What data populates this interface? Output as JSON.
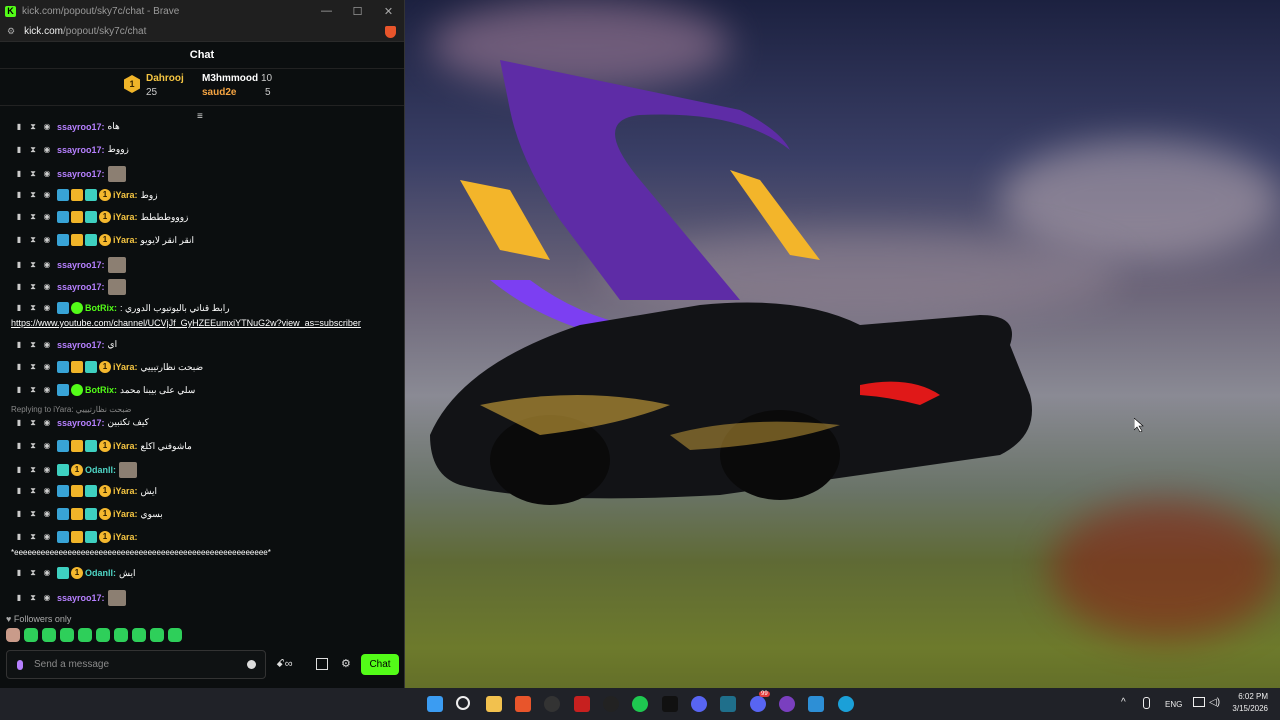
{
  "browser": {
    "title": "kick.com/popout/sky7c/chat - Brave",
    "url_host": "kick.com",
    "url_path": "/popout/sky7c/chat",
    "controls": {
      "minimize": "—",
      "maximize": "☐",
      "close": "✕"
    }
  },
  "chat": {
    "header": "Chat",
    "leaderboard": [
      {
        "name": "Dahrooj",
        "count": "25",
        "rank": "1"
      },
      {
        "name": "M3hmmood",
        "count": "10"
      },
      {
        "name": "saud2e",
        "count": "5"
      }
    ],
    "messages": [
      {
        "user": "ssayroo17:",
        "text": "هاه",
        "badges": []
      },
      {
        "user": "ssayroo17:",
        "text": "زووط",
        "badges": []
      },
      {
        "user": "ssayroo17:",
        "text": "",
        "badges": [],
        "emote": true
      },
      {
        "user": "iYara:",
        "text": "زوط",
        "badges": [
          "sky",
          "gold",
          "teal",
          "one"
        ]
      },
      {
        "user": "iYara:",
        "text": "زوووطططط",
        "badges": [
          "sky",
          "gold",
          "teal",
          "one"
        ]
      },
      {
        "user": "iYara:",
        "text": "انقر انقر لايويو",
        "badges": [
          "sky",
          "gold",
          "teal",
          "one"
        ]
      },
      {
        "user": "ssayroo17:",
        "text": "",
        "badges": [],
        "emote": true
      },
      {
        "user": "ssayroo17:",
        "text": "",
        "badges": [],
        "emote": true
      },
      {
        "user": "BotRix:",
        "text": ": رابط قناتي باليوتيوب الدوري",
        "badges": [
          "sky",
          "ver"
        ]
      },
      {
        "user": "ssayroo17:",
        "text": "اي",
        "badges": []
      },
      {
        "user": "iYara:",
        "text": "ضبحت نظارتيييي",
        "badges": [
          "sky",
          "gold",
          "teal",
          "one"
        ]
      },
      {
        "user": "BotRix:",
        "text": "سلي على بيبنا محمد",
        "badges": [
          "sky",
          "ver"
        ]
      },
      {
        "user": "ssayroo17:",
        "text": "كيف تكتبين",
        "badges": []
      },
      {
        "user": "iYara:",
        "text": "ماشوفني اكلع",
        "badges": [
          "sky",
          "gold",
          "teal",
          "one"
        ]
      },
      {
        "user": "Odanll:",
        "text": "",
        "badges": [
          "teal",
          "one"
        ],
        "emote": true
      },
      {
        "user": "iYara:",
        "text": "ايش",
        "badges": [
          "sky",
          "gold",
          "teal",
          "one"
        ]
      },
      {
        "user": "iYara:",
        "text": "بسوي",
        "badges": [
          "sky",
          "gold",
          "teal",
          "one"
        ]
      },
      {
        "user": "iYara:",
        "text": "",
        "badges": [
          "sky",
          "gold",
          "teal",
          "one"
        ]
      },
      {
        "user": "Odanll:",
        "text": "ايش",
        "badges": [
          "teal",
          "one"
        ]
      },
      {
        "user": "ssayroo17:",
        "text": "",
        "badges": [],
        "emote": true
      }
    ],
    "link_text": "https://www.youtube.com/channel/UCVjJf_GyHZEEumxiYTNuG2w?view_as=subscriber",
    "reply_note": "Replying to iYara: ضبحت نظارتيييي",
    "long_line": "*eeeeeeeeeeeeeeeeeeeeeeeeeeeeeeeeeeeeeeeeeeeeeeeeeeeeeeeee*",
    "followers_only": "Followers only",
    "input_placeholder": "Send a message",
    "send_button": "Chat"
  },
  "taskbar": {
    "lang": "ENG",
    "time": "6:02 PM",
    "date": "3/15/2026",
    "badge_count": "99"
  }
}
